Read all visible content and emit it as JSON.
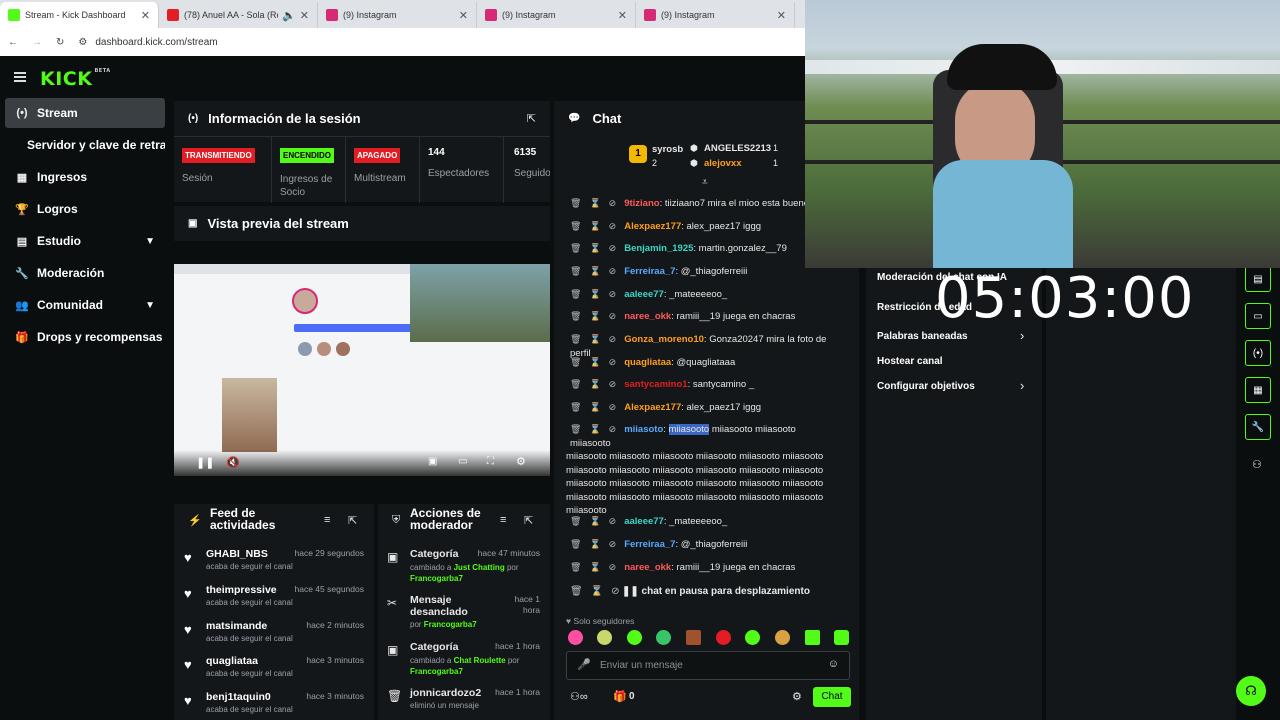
{
  "browser": {
    "tabs": [
      {
        "title": "Stream - Kick Dashboard",
        "color": "#53fc18"
      },
      {
        "title": "(78) Anuel AA - Sola (Remi",
        "color": "#e21d24"
      },
      {
        "title": "(9) Instagram",
        "color": "#d62976"
      },
      {
        "title": "(9) Instagram",
        "color": "#d62976"
      },
      {
        "title": "(9) Instagram",
        "color": "#d62976"
      }
    ],
    "url": "dashboard.kick.com/stream"
  },
  "app": {
    "logo": "KICK",
    "logo_tag": "BETA"
  },
  "sidebar": {
    "items": [
      {
        "label": "Stream",
        "icon": "(•)"
      },
      {
        "label": "Servidor y clave de retransm",
        "icon": ""
      },
      {
        "label": "Ingresos",
        "icon": "▦"
      },
      {
        "label": "Logros",
        "icon": "🏆"
      },
      {
        "label": "Estudio",
        "icon": "▤"
      },
      {
        "label": "Moderación",
        "icon": "🔧"
      },
      {
        "label": "Comunidad",
        "icon": "👥"
      },
      {
        "label": "Drops y recompensas",
        "icon": "🎁"
      }
    ]
  },
  "session": {
    "title": "Información de la sesión",
    "stats": [
      {
        "badge": "TRANSMITIENDO",
        "label": "Sesión"
      },
      {
        "badge": "ENCENDIDO",
        "label": "Ingresos de Socio"
      },
      {
        "badge": "APAGADO",
        "label": "Multistream"
      },
      {
        "value": "144",
        "label": "Espectadores"
      },
      {
        "value": "6135",
        "label": "Seguido"
      }
    ]
  },
  "preview": {
    "title": "Vista previa del stream"
  },
  "feed": {
    "title": "Feed de actividades",
    "items": [
      {
        "name": "GHABI_NBS",
        "time": "hace 29 segundos",
        "sub": "acaba de seguir el canal"
      },
      {
        "name": "theimpressive",
        "time": "hace 45 segundos",
        "sub": "acaba de seguir el canal"
      },
      {
        "name": "matsimande",
        "time": "hace 2 minutos",
        "sub": "acaba de seguir el canal"
      },
      {
        "name": "quagliataa",
        "time": "hace 3 minutos",
        "sub": "acaba de seguir el canal"
      },
      {
        "name": "benj1taquin0",
        "time": "hace 3 minutos",
        "sub": "acaba de seguir el canal"
      }
    ]
  },
  "mod": {
    "title": "Acciones de moderador",
    "items": [
      {
        "name": "Categoría",
        "time": "hace 47 minutos",
        "pre": "cambiado a",
        "target": "Just Chatting",
        "mid": "por",
        "by": "Francogarba7"
      },
      {
        "name": "Mensaje desanclado",
        "time": "hace 1 hora",
        "pre": "",
        "target": "",
        "mid": "por",
        "by": "Francogarba7"
      },
      {
        "name": "Categoría",
        "time": "hace 1 hora",
        "pre": "cambiado a",
        "target": "Chat Roulette",
        "mid": "por",
        "by": "Francogarba7"
      },
      {
        "name": "jonnicardozo2",
        "time": "hace 1 hora",
        "pre": "eliminó un mensaje",
        "target": "",
        "mid": "",
        "by": ""
      }
    ]
  },
  "chat": {
    "title": "Chat",
    "leaders": {
      "top_name": "syrosb",
      "top_rank": "1",
      "top_count": "2",
      "l2_name": "ANGELES2213",
      "l2_count": "1",
      "l3_name": "alejovxx",
      "l3_count": "1"
    },
    "messages": [
      {
        "user": "9tiziano",
        "color": "#ff5a5a",
        "text": ": tiiziaano7 mira el mioo esta bueno"
      },
      {
        "user": "Alexpaez177",
        "color": "#ff9f1c",
        "text": ": alex_paez17 iggg"
      },
      {
        "user": "Benjamin_1925",
        "color": "#3bd6c6",
        "text": ": martin.gonzalez__79"
      },
      {
        "user": "Ferreiraa_7",
        "color": "#5aa9ff",
        "text": ": @_thiagoferreiii"
      },
      {
        "user": "aaleee77",
        "color": "#3bd6c6",
        "text": ": _mateeeeoo_"
      },
      {
        "user": "naree_okk",
        "color": "#ff5a5a",
        "text": ": ramiii__19 juega en chacras"
      },
      {
        "user": "Gonza_moreno10",
        "color": "#ff9f1c",
        "text": ": Gonza20247 mira la foto de perfil"
      },
      {
        "user": "quagliataa",
        "color": "#ff9f1c",
        "text": ": @quagliataaa"
      },
      {
        "user": "santycamino1",
        "color": "#e21d24",
        "text": ": santycamino _"
      },
      {
        "user": "Alexpaez177",
        "color": "#ff9f1c",
        "text": ": alex_paez17 iggg"
      },
      {
        "user": "aaleee77",
        "color": "#3bd6c6",
        "text": ": _mateeeeoo_"
      },
      {
        "user": "Ferreiraa_7",
        "color": "#5aa9ff",
        "text": ": @_thiagoferreiii"
      },
      {
        "user": "naree_okk",
        "color": "#ff5a5a",
        "text": ": ramiii__19 juega en chacras"
      }
    ],
    "long_msg": {
      "user": "miiasoto",
      "highlight": "miiasooto",
      "first": " miiasooto miiasooto miiasooto",
      "lines": [
        "miiasooto miiasooto miiasooto miiasooto miiasooto miiasooto",
        "miiasooto miiasooto miiasooto miiasooto miiasooto miiasooto",
        "miiasooto miiasooto miiasooto miiasooto miiasooto miiasooto",
        "miiasooto miiasooto miiasooto miiasooto miiasooto miiasooto",
        "miiasooto"
      ]
    },
    "paused": "chat en pausa para desplazamiento",
    "followers_only": "Solo seguidores",
    "input_placeholder": "Enviar un mensaje",
    "send_label": "Chat",
    "count": "0"
  },
  "right_menu": {
    "items": [
      {
        "label": "Moderación del chat con IA"
      },
      {
        "label": "Restricción de edad"
      },
      {
        "label": "Palabras baneadas"
      },
      {
        "label": "Hostear canal"
      },
      {
        "label": "Configurar objetivos"
      }
    ]
  },
  "timer": "05:03:00",
  "colors": {
    "accent": "#53fc18",
    "bg": "#0b0e0f",
    "panel": "#141719",
    "live": "#e21d24"
  }
}
